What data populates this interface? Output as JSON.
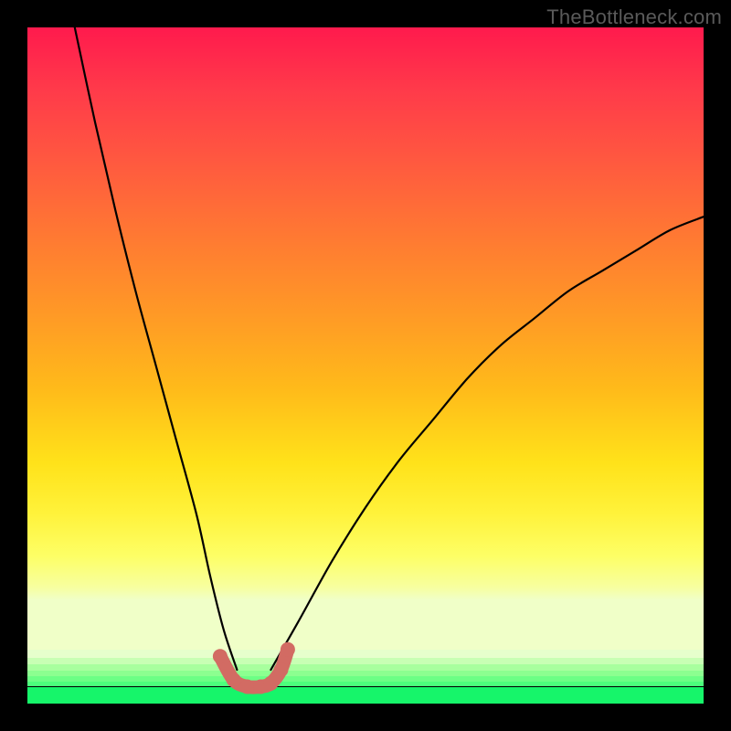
{
  "watermark": "TheBottleneck.com",
  "chart_data": {
    "type": "line",
    "title": "",
    "xlabel": "",
    "ylabel": "",
    "xlim": [
      0,
      100
    ],
    "ylim": [
      0,
      100
    ],
    "note": "V-shaped bottleneck curve; minimum ≈ x 30–38 at y ≈ 2–4. Left branch rises steeply to y=100 near x≈7; right branch rises to y≈72 at x=100. Background is a red→yellow→green vertical gradient (red at top = high bottleneck). Salmon markers highlight the trough region.",
    "series": [
      {
        "name": "left-branch",
        "x": [
          7,
          10,
          13,
          16,
          19,
          22,
          25,
          27,
          29,
          31
        ],
        "values": [
          100,
          86,
          73,
          61,
          50,
          39,
          28,
          19,
          11,
          5
        ]
      },
      {
        "name": "right-branch",
        "x": [
          36,
          40,
          45,
          50,
          55,
          60,
          65,
          70,
          75,
          80,
          85,
          90,
          95,
          100
        ],
        "values": [
          5,
          12,
          21,
          29,
          36,
          42,
          48,
          53,
          57,
          61,
          64,
          67,
          70,
          72
        ]
      },
      {
        "name": "trough-markers",
        "x": [
          28.5,
          30.5,
          32.5,
          34.5,
          36.0,
          37.5,
          38.5
        ],
        "values": [
          7,
          3.5,
          2.5,
          2.5,
          3.0,
          5.0,
          8.0
        ]
      }
    ],
    "colors": {
      "curve": "#000000",
      "marker": "#d26b63",
      "gradient_top": "#ff1a4d",
      "gradient_mid": "#ffe21a",
      "gradient_bottom": "#16f56a"
    }
  }
}
